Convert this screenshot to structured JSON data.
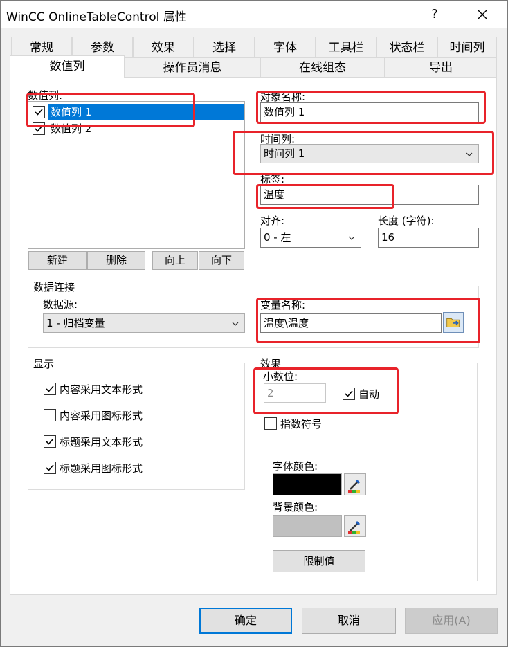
{
  "window": {
    "title": "WinCC OnlineTableControl 属性",
    "help_label": "?"
  },
  "tabs": {
    "row1": [
      "常规",
      "参数",
      "效果",
      "选择",
      "字体",
      "工具栏",
      "状态栏",
      "时间列"
    ],
    "row2": [
      "数值列",
      "操作员消息",
      "在线组态",
      "导出"
    ],
    "active": "数值列"
  },
  "value_columns": {
    "label": "数值列:",
    "items": [
      {
        "label": "数值列 1",
        "checked": true,
        "selected": true
      },
      {
        "label": "数值列 2",
        "checked": true,
        "selected": false
      }
    ],
    "buttons": {
      "new": "新建",
      "delete": "删除",
      "up": "向上",
      "down": "向下"
    }
  },
  "object_name": {
    "label": "对象名称:",
    "value": "数值列 1"
  },
  "time_column": {
    "label": "时间列:",
    "value": "时间列 1"
  },
  "tag_label": {
    "label": "标签:",
    "value": "温度"
  },
  "alignment": {
    "label": "对齐:",
    "value": "0 - 左"
  },
  "length": {
    "label": "长度 (字符):",
    "value": "16"
  },
  "data_connection": {
    "group_label": "数据连接",
    "source_label": "数据源:",
    "source_value": "1 - 归档变量",
    "variable_label": "变量名称:",
    "variable_value": "温度\\温度"
  },
  "display": {
    "group_label": "显示",
    "options": [
      {
        "label": "内容采用文本形式",
        "checked": true
      },
      {
        "label": "内容采用图标形式",
        "checked": false
      },
      {
        "label": "标题采用文本形式",
        "checked": true
      },
      {
        "label": "标题采用图标形式",
        "checked": true
      }
    ]
  },
  "effects": {
    "group_label": "效果",
    "decimals_label": "小数位:",
    "decimals_value": "2",
    "auto_label": "自动",
    "auto_checked": true,
    "exponent_label": "指数符号",
    "exponent_checked": false,
    "font_color_label": "字体颜色:",
    "font_color": "#000000",
    "bg_color_label": "背景颜色:",
    "bg_color": "#c0c0c0",
    "limits_button": "限制值"
  },
  "footer": {
    "ok": "确定",
    "cancel": "取消",
    "apply": "应用(A)"
  },
  "colors": {
    "highlight": "#0078d7",
    "annotation_red": "#e8232a"
  }
}
